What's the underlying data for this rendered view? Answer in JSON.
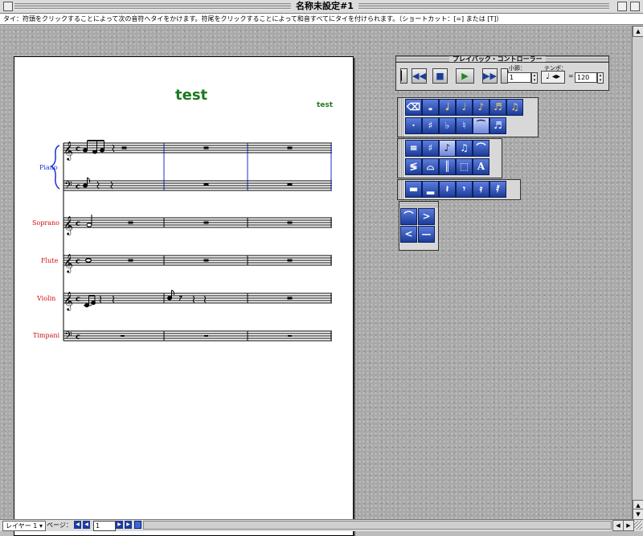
{
  "window": {
    "title": "名称未設定#1"
  },
  "hint": {
    "text": "タイ：符頭をクリックすることによって次の音符へタイをかけます。符尾をクリックすることによって和音すべてにタイを付けられます。（ショートカット：[=] または [T]）"
  },
  "score": {
    "title": "test",
    "composer": "test",
    "instruments": [
      "Piano",
      "Soprano",
      "Flute",
      "Violin",
      "Timpani"
    ],
    "colors": {
      "title": "#1d7a1d",
      "piano": "#1a2fd6",
      "others": "#d01010"
    }
  },
  "playback": {
    "title": "プレイバック・コントローラー",
    "measure_label": "小節：",
    "measure_value": "1",
    "tempo_label": "テンポ：",
    "tempo_equals": "=",
    "tempo_value": "120",
    "buttons": [
      "rewind-start-icon",
      "rewind-icon",
      "stop-icon",
      "play-icon",
      "fast-forward-icon",
      "end-icon"
    ]
  },
  "bottom": {
    "layer": "レイヤー 1",
    "page_label": "ページ：",
    "page_value": "1"
  }
}
